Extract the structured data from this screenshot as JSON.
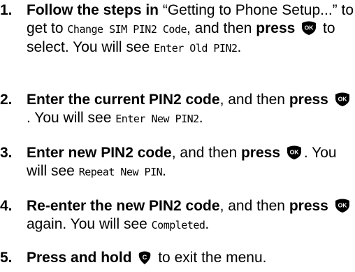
{
  "steps": [
    {
      "number": "1.",
      "bold_lead": "Follow the steps in",
      "text_a": " “Getting to Phone Setup...” to get to ",
      "lcd_a": "Change SIM PIN2 Code",
      "text_b": ", and then ",
      "bold_press": "press",
      "key": "ok-key-icon",
      "text_c": " to select. You will see ",
      "lcd_b": "Enter Old PIN2",
      "text_d": "."
    },
    {
      "number": "2.",
      "bold_lead": "Enter the current PIN2 code",
      "text_a": ", and then ",
      "bold_press": "press",
      "key": "ok-key-icon",
      "text_b": ". You will see ",
      "lcd_a": "Enter New PIN2",
      "text_c": "."
    },
    {
      "number": "3.",
      "bold_lead": "Enter new PIN2 code",
      "text_a": ", and then ",
      "bold_press": "press",
      "key": "ok-key-icon",
      "text_b": ". You will see ",
      "lcd_a": "Repeat New PIN",
      "text_c": "."
    },
    {
      "number": "4.",
      "bold_lead": "Re-enter the new PIN2 code",
      "text_a": ", and then ",
      "bold_press": "press",
      "key": "ok-key-icon",
      "text_b": " again. You will see ",
      "lcd_a": "Completed",
      "text_c": "."
    },
    {
      "number": "5.",
      "bold_lead": "Press and hold",
      "key": "c-key-icon",
      "text_a": " to exit the menu."
    }
  ],
  "keys": {
    "ok_label": "OK",
    "c_label": "C",
    "key_color": "#000000"
  }
}
